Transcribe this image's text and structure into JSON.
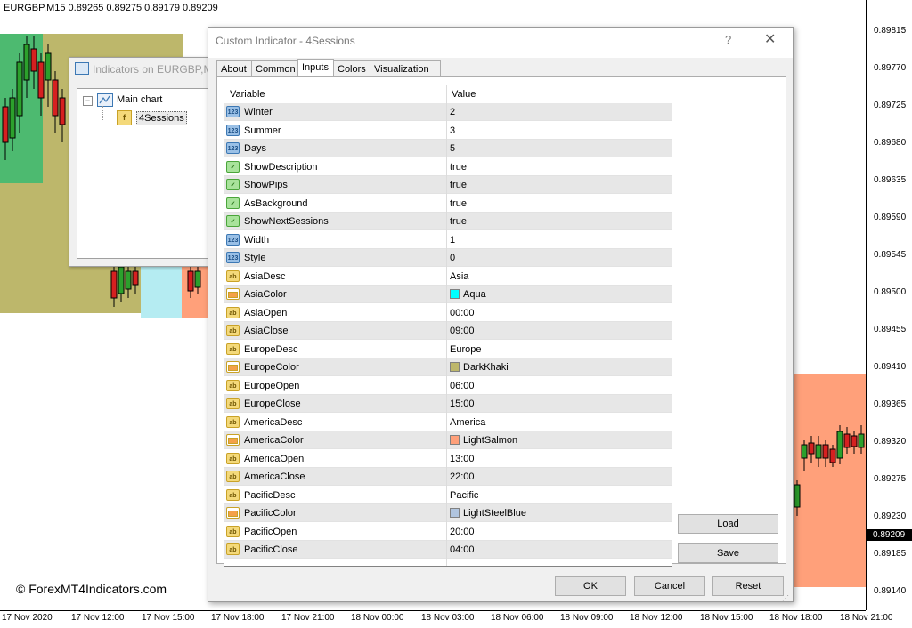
{
  "chart": {
    "header": "EURGBP,M15  0.89265 0.89275 0.89179 0.89209",
    "price_labels": [
      "0.89815",
      "0.89770",
      "0.89725",
      "0.89680",
      "0.89635",
      "0.89590",
      "0.89545",
      "0.89500",
      "0.89455",
      "0.89410",
      "0.89365",
      "0.89320",
      "0.89275",
      "0.89230",
      "0.89185",
      "0.89140"
    ],
    "current_price": "0.89209",
    "time_labels": [
      "17 Nov 2020",
      "17 Nov 12:00",
      "17 Nov 15:00",
      "17 Nov 18:00",
      "17 Nov 21:00",
      "18 Nov 00:00",
      "18 Nov 03:00",
      "18 Nov 06:00",
      "18 Nov 09:00",
      "18 Nov 12:00",
      "18 Nov 15:00",
      "18 Nov 18:00",
      "18 Nov 21:00"
    ],
    "watermark": "© ForexMT4Indicators.com",
    "colors": {
      "europe": "#BDB76B",
      "asia": "#7fcf8f",
      "america": "#FFA07A",
      "aqua": "#b5ecf2"
    }
  },
  "indicators_window": {
    "title": "Indicators on EURGBP,M",
    "tree_root": "Main chart",
    "tree_child": "4Sessions"
  },
  "dialog": {
    "title": "Custom Indicator - 4Sessions",
    "help": "?",
    "tabs": [
      "About",
      "Common",
      "Inputs",
      "Colors",
      "Visualization"
    ],
    "active_tab": "Inputs",
    "columns": {
      "variable": "Variable",
      "value": "Value"
    },
    "params": [
      {
        "type": "int",
        "name": "Winter",
        "value": "2"
      },
      {
        "type": "int",
        "name": "Summer",
        "value": "3"
      },
      {
        "type": "int",
        "name": "Days",
        "value": "5"
      },
      {
        "type": "bool",
        "name": "ShowDescription",
        "value": "true"
      },
      {
        "type": "bool",
        "name": "ShowPips",
        "value": "true"
      },
      {
        "type": "bool",
        "name": "AsBackground",
        "value": "true"
      },
      {
        "type": "bool",
        "name": "ShowNextSessions",
        "value": "true"
      },
      {
        "type": "int",
        "name": "Width",
        "value": "1"
      },
      {
        "type": "int",
        "name": "Style",
        "value": "0"
      },
      {
        "type": "str",
        "name": "AsiaDesc",
        "value": "Asia"
      },
      {
        "type": "color",
        "name": "AsiaColor",
        "value": "Aqua",
        "swatch": "#00FFFF"
      },
      {
        "type": "str",
        "name": "AsiaOpen",
        "value": "00:00"
      },
      {
        "type": "str",
        "name": "AsiaClose",
        "value": "09:00"
      },
      {
        "type": "str",
        "name": "EuropeDesc",
        "value": "Europe"
      },
      {
        "type": "color",
        "name": "EuropeColor",
        "value": "DarkKhaki",
        "swatch": "#BDB76B"
      },
      {
        "type": "str",
        "name": "EuropeOpen",
        "value": "06:00"
      },
      {
        "type": "str",
        "name": "EuropeClose",
        "value": "15:00"
      },
      {
        "type": "str",
        "name": "AmericaDesc",
        "value": "America"
      },
      {
        "type": "color",
        "name": "AmericaColor",
        "value": "LightSalmon",
        "swatch": "#FFA07A"
      },
      {
        "type": "str",
        "name": "AmericaOpen",
        "value": "13:00"
      },
      {
        "type": "str",
        "name": "AmericaClose",
        "value": "22:00"
      },
      {
        "type": "str",
        "name": "PacificDesc",
        "value": "Pacific"
      },
      {
        "type": "color",
        "name": "PacificColor",
        "value": "LightSteelBlue",
        "swatch": "#B0C4DE"
      },
      {
        "type": "str",
        "name": "PacificOpen",
        "value": "20:00"
      },
      {
        "type": "str",
        "name": "PacificClose",
        "value": "04:00"
      }
    ],
    "buttons": {
      "load": "Load",
      "save": "Save",
      "ok": "OK",
      "cancel": "Cancel",
      "reset": "Reset"
    }
  }
}
